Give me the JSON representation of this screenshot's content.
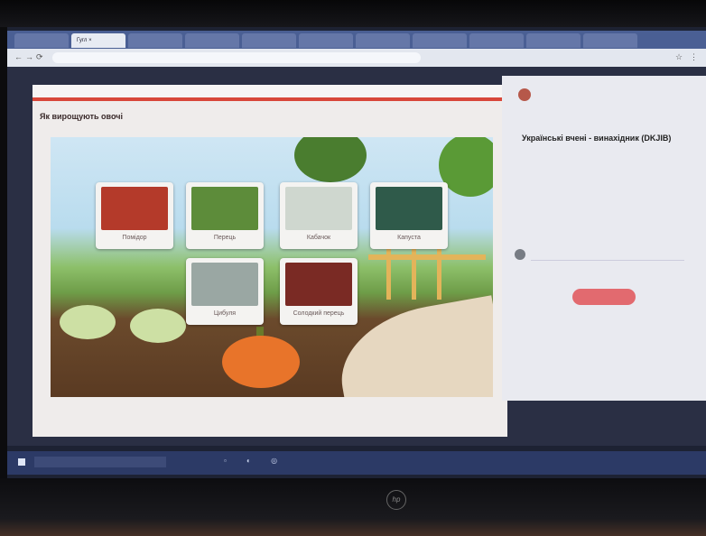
{
  "browser": {
    "tabs": [
      "",
      "Гугл ×",
      "",
      "",
      "",
      "",
      "",
      "",
      "",
      "",
      ""
    ],
    "url": ""
  },
  "app": {
    "time": "",
    "title": "",
    "heading": "Як вирощують овочі",
    "cards": [
      {
        "label": "Помідор",
        "color": "#b43a2a"
      },
      {
        "label": "Перець",
        "color": "#5d8c3a"
      },
      {
        "label": "Кабачок",
        "color": "#cfd7cf"
      },
      {
        "label": "Капуста",
        "color": "#2f5a4a"
      },
      {
        "label": "Цибуля",
        "color": "#9aa7a3"
      },
      {
        "label": "Солодкий перець",
        "color": "#7a2a24"
      }
    ]
  },
  "sidebar": {
    "author": "",
    "title": "Українські вчені - винахідник (DKJIB)",
    "description": "",
    "date": "",
    "comment_placeholder": "",
    "button": ""
  },
  "taskbar": {
    "search": "",
    "tray": ""
  },
  "device": {
    "logo": "hp"
  }
}
